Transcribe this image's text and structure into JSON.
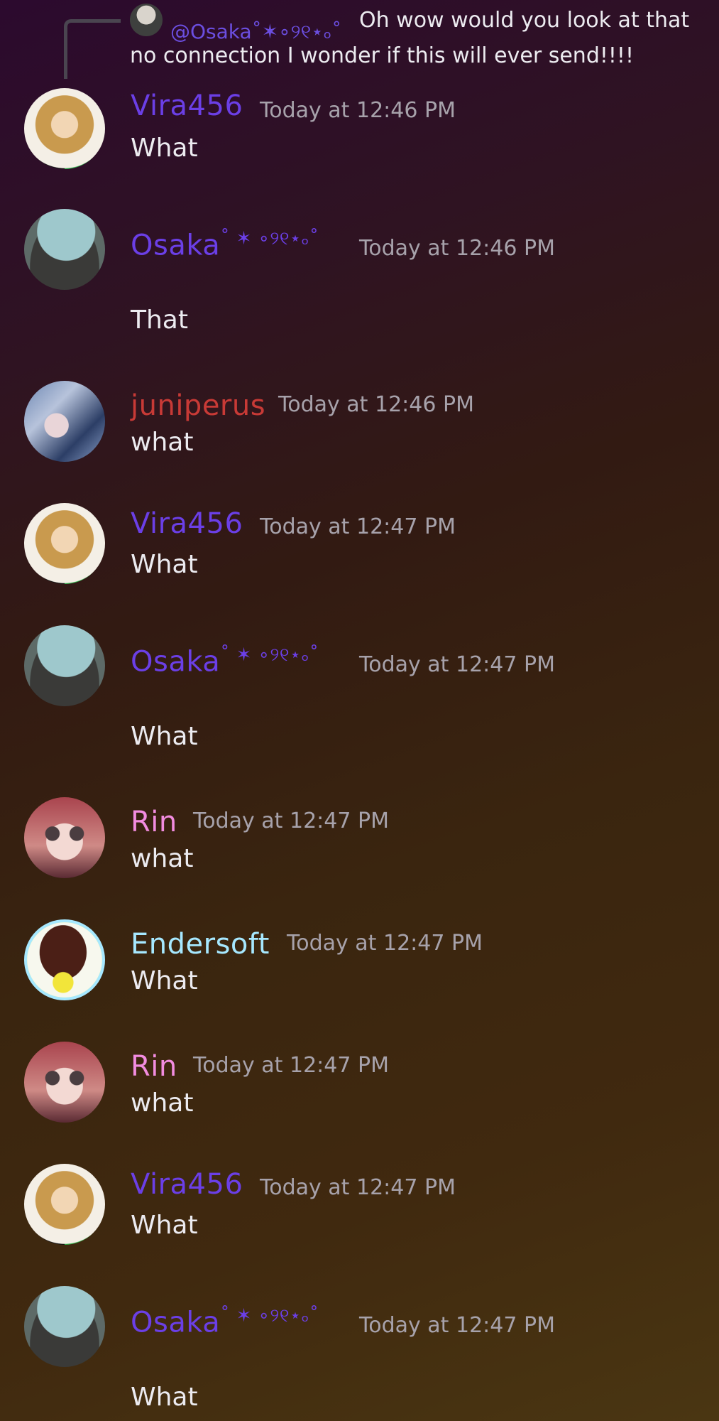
{
  "reply": {
    "mention": "@Osaka˚✶∘୨୧⋆ₒ˚",
    "text": "Oh wow would you look at that no connection I wonder if this will ever send!!!!"
  },
  "messages": [
    {
      "author": "Vira456",
      "time": "Today at 12:46 PM",
      "text": "What",
      "color": "#6b3fe6",
      "avatar": "vira"
    },
    {
      "author": "Osaka",
      "deco": "˚ ✶ ∘୨୧⋆ₒ˚",
      "time": "Today at 12:46 PM",
      "text": "That",
      "color": "#6b3fe6",
      "avatar": "osaka"
    },
    {
      "author": "juniperus",
      "time": "Today at 12:46 PM",
      "text": "what",
      "color": "#c83a36",
      "avatar": "juniperus"
    },
    {
      "author": "Vira456",
      "time": "Today at 12:47 PM",
      "text": "What",
      "color": "#6b3fe6",
      "avatar": "vira"
    },
    {
      "author": "Osaka",
      "deco": "˚ ✶ ∘୨୧⋆ₒ˚",
      "time": "Today at 12:47 PM",
      "text": "What",
      "color": "#6b3fe6",
      "avatar": "osaka"
    },
    {
      "author": "Rin",
      "time": "Today at 12:47 PM",
      "text": "what",
      "color": "#f28ce0",
      "avatar": "rin"
    },
    {
      "author": "Endersoft",
      "time": "Today at 12:47 PM",
      "text": "What",
      "color": "#a6e8ff",
      "avatar": "endersoft"
    },
    {
      "author": "Rin",
      "time": "Today at 12:47 PM",
      "text": "what",
      "color": "#f28ce0",
      "avatar": "rin"
    },
    {
      "author": "Vira456",
      "time": "Today at 12:47 PM",
      "text": "What",
      "color": "#6b3fe6",
      "avatar": "vira"
    },
    {
      "author": "Osaka",
      "deco": "˚ ✶ ∘୨୧⋆ₒ˚",
      "time": "Today at 12:47 PM",
      "text": "What",
      "color": "#6b3fe6",
      "avatar": "osaka"
    }
  ]
}
